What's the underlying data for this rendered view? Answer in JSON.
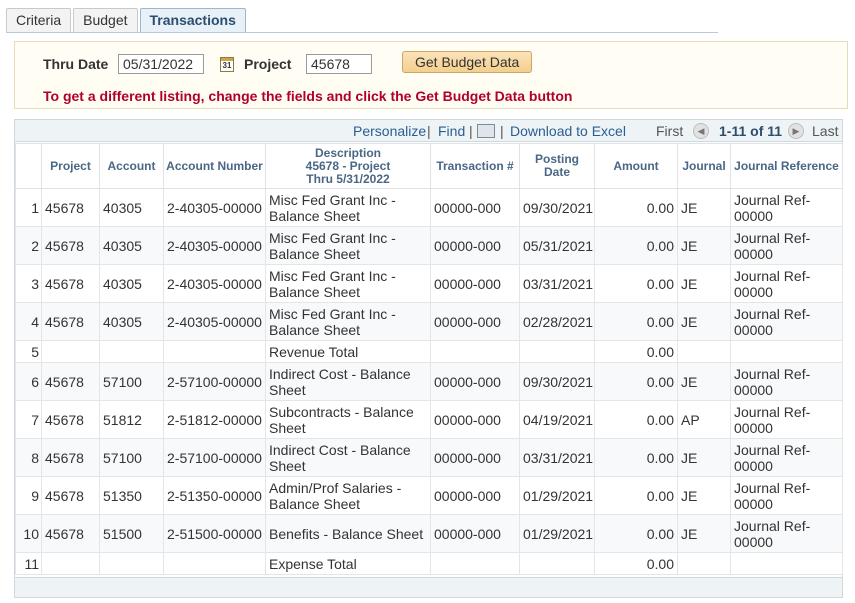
{
  "tabs": [
    "Criteria",
    "Budget",
    "Transactions"
  ],
  "criteria": {
    "thru_date_label": "Thru Date",
    "thru_date_value": "05/31/2022",
    "calendar_glyph": "31",
    "project_label": "Project",
    "project_value": "45678",
    "button_label": "Get Budget Data",
    "message": "To get a different listing, change the fields and click the Get Budget Data button"
  },
  "gridbar": {
    "personalize": "Personalize",
    "find": "Find",
    "download": "Download to Excel",
    "first": "First",
    "range": "1-11 of 11",
    "last": "Last"
  },
  "columns": {
    "project": "Project",
    "account": "Account",
    "account_number": "Account Number",
    "description_1": "Description",
    "description_2": "45678 - Project",
    "description_3": "Thru 5/31/2022",
    "transaction": "Transaction #",
    "posting_date": "Posting Date",
    "amount": "Amount",
    "journal": "Journal",
    "journal_reference": "Journal Reference"
  },
  "rows": [
    {
      "n": "1",
      "project": "45678",
      "account": "40305",
      "account_number": "2-40305-00000",
      "description": "Misc Fed Grant Inc - Balance Sheet",
      "transaction": "00000-000",
      "posting_date": "09/30/2021",
      "amount": "0.00",
      "journal": "JE",
      "journal_reference": "Journal Ref-00000"
    },
    {
      "n": "2",
      "project": "45678",
      "account": "40305",
      "account_number": "2-40305-00000",
      "description": "Misc Fed Grant Inc - Balance Sheet",
      "transaction": "00000-000",
      "posting_date": "05/31/2021",
      "amount": "0.00",
      "journal": "JE",
      "journal_reference": "Journal Ref-00000"
    },
    {
      "n": "3",
      "project": "45678",
      "account": "40305",
      "account_number": "2-40305-00000",
      "description": "Misc Fed Grant Inc - Balance Sheet",
      "transaction": "00000-000",
      "posting_date": "03/31/2021",
      "amount": "0.00",
      "journal": "JE",
      "journal_reference": "Journal Ref-00000"
    },
    {
      "n": "4",
      "project": "45678",
      "account": "40305",
      "account_number": "2-40305-00000",
      "description": "Misc Fed Grant Inc - Balance Sheet",
      "transaction": "00000-000",
      "posting_date": "02/28/2021",
      "amount": "0.00",
      "journal": "JE",
      "journal_reference": "Journal Ref-00000"
    },
    {
      "n": "5",
      "project": "",
      "account": "",
      "account_number": "",
      "description": "Revenue Total",
      "transaction": "",
      "posting_date": "",
      "amount": "0.00",
      "journal": "",
      "journal_reference": ""
    },
    {
      "n": "6",
      "project": "45678",
      "account": "57100",
      "account_number": "2-57100-00000",
      "description": "Indirect Cost - Balance Sheet",
      "transaction": "00000-000",
      "posting_date": "09/30/2021",
      "amount": "0.00",
      "journal": "JE",
      "journal_reference": "Journal Ref-00000"
    },
    {
      "n": "7",
      "project": "45678",
      "account": "51812",
      "account_number": "2-51812-00000",
      "description": "Subcontracts - Balance Sheet",
      "transaction": "00000-000",
      "posting_date": "04/19/2021",
      "amount": "0.00",
      "journal": "AP",
      "journal_reference": "Journal Ref-00000"
    },
    {
      "n": "8",
      "project": "45678",
      "account": "57100",
      "account_number": "2-57100-00000",
      "description": "Indirect Cost - Balance Sheet",
      "transaction": "00000-000",
      "posting_date": "03/31/2021",
      "amount": "0.00",
      "journal": "JE",
      "journal_reference": "Journal Ref-00000"
    },
    {
      "n": "9",
      "project": "45678",
      "account": "51350",
      "account_number": "2-51350-00000",
      "description": "Admin/Prof Salaries - Balance Sheet",
      "transaction": "00000-000",
      "posting_date": "01/29/2021",
      "amount": "0.00",
      "journal": "JE",
      "journal_reference": "Journal Ref-00000"
    },
    {
      "n": "10",
      "project": "45678",
      "account": "51500",
      "account_number": "2-51500-00000",
      "description": "Benefits - Balance Sheet",
      "transaction": "00000-000",
      "posting_date": "01/29/2021",
      "amount": "0.00",
      "journal": "JE",
      "journal_reference": "Journal Ref-00000"
    },
    {
      "n": "11",
      "project": "",
      "account": "",
      "account_number": "",
      "description": "Expense Total",
      "transaction": "",
      "posting_date": "",
      "amount": "0.00",
      "journal": "",
      "journal_reference": ""
    }
  ],
  "colors": {
    "accent_link": "#2a5f91",
    "message_red": "#b0002c",
    "button_orange": "#f4cf8e",
    "header_blue": "#4a6785"
  },
  "icons": {
    "calendar": "calendar-icon",
    "new_window": "new-window-icon",
    "first": "nav-first-icon",
    "last": "nav-last-icon"
  }
}
